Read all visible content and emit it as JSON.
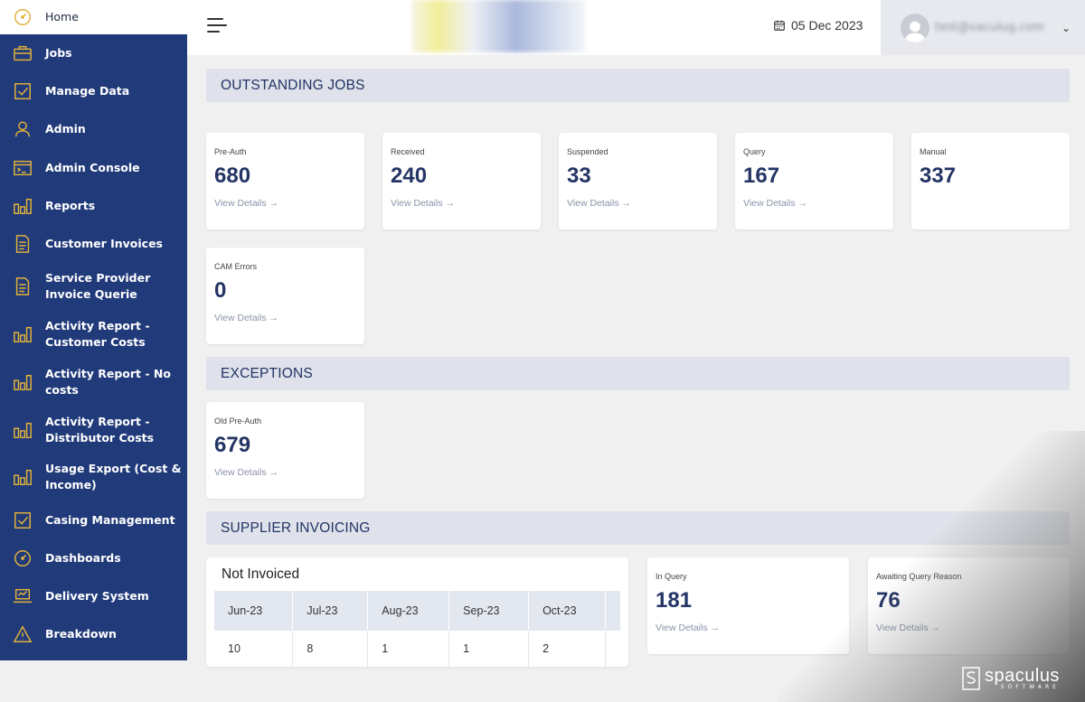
{
  "sidebar": {
    "home_label": "Home",
    "items": [
      {
        "label": "Jobs",
        "icon": "briefcase-icon"
      },
      {
        "label": "Manage Data",
        "icon": "checkbox-icon"
      },
      {
        "label": "Admin",
        "icon": "user-icon"
      },
      {
        "label": "Admin Console",
        "icon": "console-icon"
      },
      {
        "label": "Reports",
        "icon": "bar-chart-icon"
      },
      {
        "label": "Customer Invoices",
        "icon": "document-icon"
      },
      {
        "label": "Service Provider Invoice Querie",
        "icon": "document-icon"
      },
      {
        "label": "Activity Report - Customer Costs",
        "icon": "bar-chart-icon"
      },
      {
        "label": "Activity Report - No costs",
        "icon": "bar-chart-icon"
      },
      {
        "label": "Activity Report - Distributor Costs",
        "icon": "bar-chart-icon"
      },
      {
        "label": "Usage Export (Cost & Income)",
        "icon": "bar-chart-icon"
      },
      {
        "label": "Casing Management",
        "icon": "checkbox-icon"
      },
      {
        "label": "Dashboards",
        "icon": "gauge-icon"
      },
      {
        "label": "Delivery System",
        "icon": "laptop-icon"
      },
      {
        "label": "Breakdown",
        "icon": "warning-icon"
      }
    ],
    "colors": {
      "background": "#213a7a",
      "icon": "#e0b23a"
    }
  },
  "header": {
    "date": "05 Dec 2023",
    "user_email": "test@vaculug.com"
  },
  "sections": {
    "outstanding": "OUTSTANDING JOBS",
    "exceptions": "EXCEPTIONS",
    "supplier": "SUPPLIER INVOICING"
  },
  "outstanding_cards": [
    {
      "label": "Pre-Auth",
      "value": "680",
      "link": "View Details →"
    },
    {
      "label": "Received",
      "value": "240",
      "link": "View Details →"
    },
    {
      "label": "Suspended",
      "value": "33",
      "link": "View Details →"
    },
    {
      "label": "Query",
      "value": "167",
      "link": "View Details →"
    },
    {
      "label": "Manual",
      "value": "337"
    },
    {
      "label": "CAM Errors",
      "value": "0",
      "link": "View Details →"
    }
  ],
  "exception_cards": [
    {
      "label": "Old Pre-Auth",
      "value": "679",
      "link": "View Details →"
    }
  ],
  "not_invoiced": {
    "title": "Not Invoiced",
    "columns": [
      "Jun-23",
      "Jul-23",
      "Aug-23",
      "Sep-23",
      "Oct-23"
    ],
    "values": [
      "10",
      "8",
      "1",
      "1",
      "2"
    ]
  },
  "supplier_cards": [
    {
      "label": "In Query",
      "value": "181",
      "link": "View Details →"
    },
    {
      "label": "Awaiting Query Reason",
      "value": "76",
      "link": "View Details →"
    }
  ],
  "watermark": {
    "name": "spaculus",
    "sub": "SOFTWARE"
  }
}
